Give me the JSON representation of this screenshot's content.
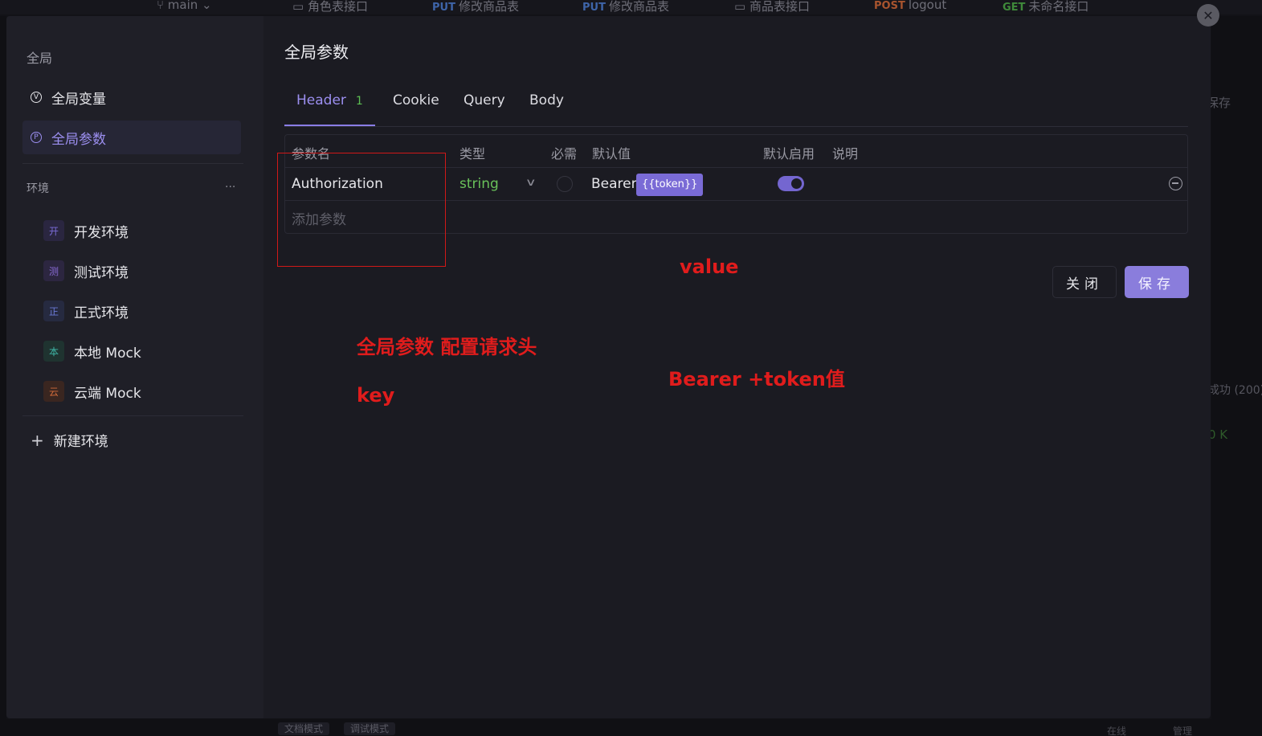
{
  "background": {
    "tabs": [
      {
        "method": "",
        "label": "main",
        "icon": "branch-icon"
      },
      {
        "method": "",
        "label": "角色表接口",
        "icon": "folder-icon"
      },
      {
        "method": "PUT",
        "label": "修改商品表"
      },
      {
        "method": "PUT",
        "label": "修改商品表"
      },
      {
        "method": "",
        "label": "商品表接口",
        "icon": "folder-icon"
      },
      {
        "method": "POST",
        "label": "logout"
      },
      {
        "method": "GET",
        "label": "未命名接口"
      }
    ],
    "right_texts": [
      "保存",
      "成功 (200)",
      "0 K"
    ],
    "bottom": [
      "文档模式",
      "调试模式",
      "在线",
      "管理"
    ]
  },
  "sidebar": {
    "global_section": "全局",
    "global_items": [
      {
        "label": "全局变量",
        "icon": "V",
        "active": false
      },
      {
        "label": "全局参数",
        "icon": "P",
        "active": true
      }
    ],
    "env_section": "环境",
    "env_more": "···",
    "environments": [
      {
        "badge": "开",
        "label": "开发环境",
        "color": "#7a6bd6",
        "bg": "#2a2640"
      },
      {
        "badge": "测",
        "label": "测试环境",
        "color": "#8a6bd6",
        "bg": "#2c2640"
      },
      {
        "badge": "正",
        "label": "正式环境",
        "color": "#6b7ad6",
        "bg": "#262a40"
      },
      {
        "badge": "本",
        "label": "本地 Mock",
        "color": "#3fb8a8",
        "bg": "#1f3330"
      },
      {
        "badge": "云",
        "label": "云端 Mock",
        "color": "#d06a3a",
        "bg": "#3a2620"
      }
    ],
    "new_env": "新建环境"
  },
  "main": {
    "title": "全局参数",
    "tabs": [
      {
        "label": "Header",
        "count": "1",
        "active": true
      },
      {
        "label": "Cookie",
        "count": "",
        "active": false
      },
      {
        "label": "Query",
        "count": "",
        "active": false
      },
      {
        "label": "Body",
        "count": "",
        "active": false
      }
    ],
    "columns": [
      "参数名",
      "类型",
      "必需",
      "默认值",
      "默认启用",
      "说明"
    ],
    "row": {
      "name": "Authorization",
      "type": "string",
      "required": false,
      "default_text": "Bearer",
      "default_token": "{{token}}",
      "enabled": true
    },
    "add_param": "添加参数",
    "close_label": "关闭",
    "save_label": "保存"
  },
  "annotations": {
    "value": "value",
    "title": "全局参数 配置请求头",
    "bearer": "Bearer +token值",
    "key": "key"
  }
}
